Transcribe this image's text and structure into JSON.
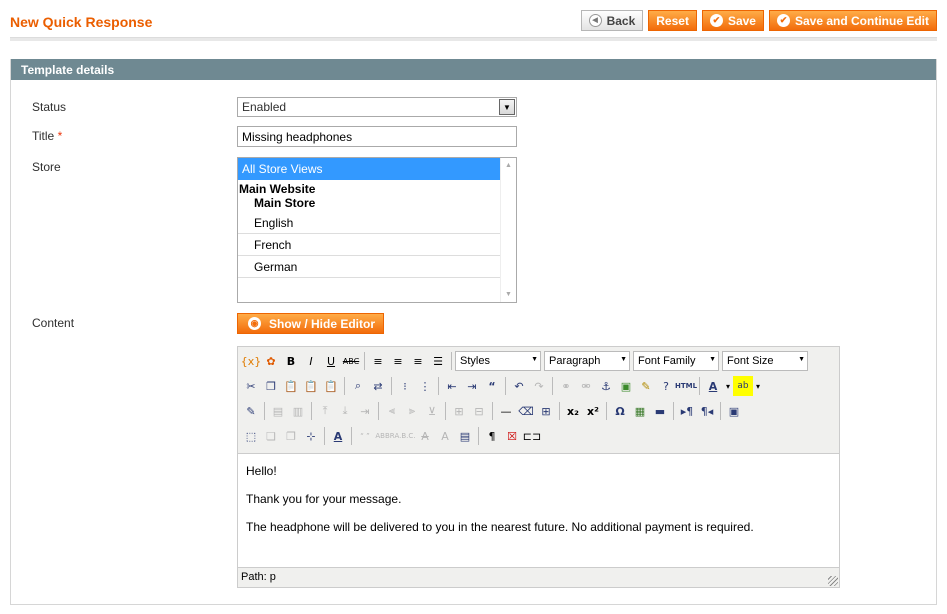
{
  "page": {
    "title": "New Quick Response"
  },
  "actions": {
    "back": "Back",
    "reset": "Reset",
    "save": "Save",
    "save_continue": "Save and Continue Edit"
  },
  "fieldset": {
    "legend": "Template details"
  },
  "form": {
    "status_label": "Status",
    "status_value": "Enabled",
    "title_label": "Title",
    "title_required_mark": "*",
    "title_value": "Missing headphones",
    "store_label": "Store",
    "content_label": "Content"
  },
  "store_options": {
    "all": "All Store Views",
    "website": "Main Website",
    "store": "Main Store",
    "views": [
      "English",
      "French",
      "German"
    ]
  },
  "editor": {
    "toggle_label": "Show / Hide Editor",
    "dropdowns": {
      "styles": "Styles",
      "format": "Paragraph",
      "font_family": "Font Family",
      "font_size": "Font Size"
    },
    "content": [
      "Hello!",
      "Thank you for your message.",
      "The headphone will be delivered to you in the nearest future. No additional payment is required."
    ],
    "path": "Path: p"
  },
  "colors": {
    "accent": "#eb5e00",
    "button": "#f26c0b",
    "legend_bg": "#6f8992",
    "selection": "#3399ff"
  }
}
